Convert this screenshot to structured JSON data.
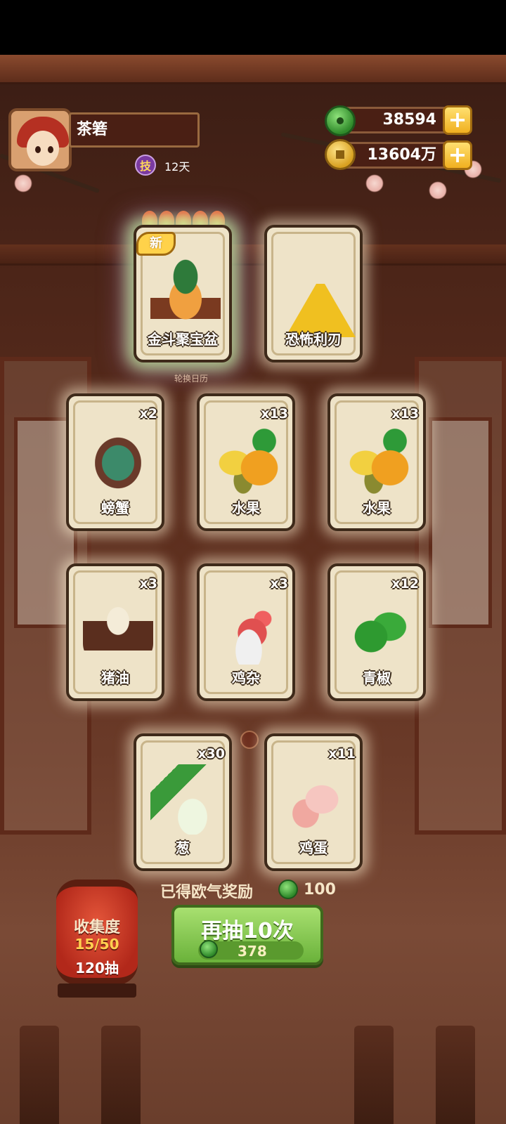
{
  "player": {
    "name": "茶箬",
    "skill_icon_text": "技",
    "skill_days": "12天"
  },
  "currencies": {
    "jade": "38594",
    "coins": "13604万",
    "plus_label": "+"
  },
  "featured_cards": [
    {
      "name": "金斗聚宝盆",
      "tag": "新",
      "rare": true,
      "icon": "treasure-bowl-icon"
    },
    {
      "name": "恐怖利刃",
      "icon": "warning-blade-icon"
    }
  ],
  "calendar_label": "轮换日历",
  "cards": [
    {
      "name": "螃蟹",
      "qty": "x2",
      "icon": "crab-icon"
    },
    {
      "name": "水果",
      "qty": "x13",
      "icon": "fruit-icon"
    },
    {
      "name": "水果",
      "qty": "x13",
      "icon": "fruit-icon"
    },
    {
      "name": "猪油",
      "qty": "x3",
      "icon": "lard-icon"
    },
    {
      "name": "鸡杂",
      "qty": "x3",
      "icon": "chicken-icon"
    },
    {
      "name": "青椒",
      "qty": "x12",
      "icon": "green-pepper-icon"
    },
    {
      "name": "葱",
      "qty": "x30",
      "icon": "scallion-icon"
    },
    {
      "name": "鸡蛋",
      "qty": "x11",
      "icon": "egg-icon"
    }
  ],
  "reward": {
    "label": "已得欧气奖励",
    "value": "100"
  },
  "draw_button": {
    "label": "再抽10次",
    "cost": "378"
  },
  "collection": {
    "label": "收集度",
    "progress": "15/50",
    "draws": "120抽"
  },
  "colors": {
    "jade": "#2f8a2a",
    "gold": "#f0b020",
    "button_green": "#6ab23a",
    "lantern_red": "#b2281a"
  }
}
